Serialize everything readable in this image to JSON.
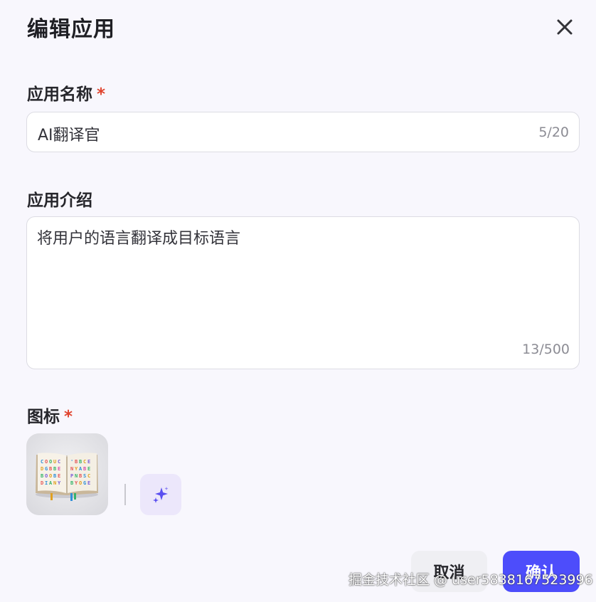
{
  "dialog": {
    "title": "编辑应用"
  },
  "name_field": {
    "label": "应用名称",
    "required_mark": "*",
    "value": "AI翻译官",
    "counter": "5/20"
  },
  "desc_field": {
    "label": "应用介绍",
    "value": "将用户的语言翻译成目标语言",
    "counter": "13/500"
  },
  "icon_field": {
    "label": "图标",
    "required_mark": "*",
    "icon_image": "open-book-colorful-letters",
    "generate_icon": "sparkle-icon"
  },
  "footer": {
    "cancel_label": "取消",
    "confirm_label": "确认"
  },
  "watermark": "掘金技术社区 @ user5838167523996",
  "colors": {
    "background": "#f8f7fd",
    "accent": "#4d4dfb",
    "required": "#e0442f",
    "ai_button_bg": "#ece7fb"
  }
}
